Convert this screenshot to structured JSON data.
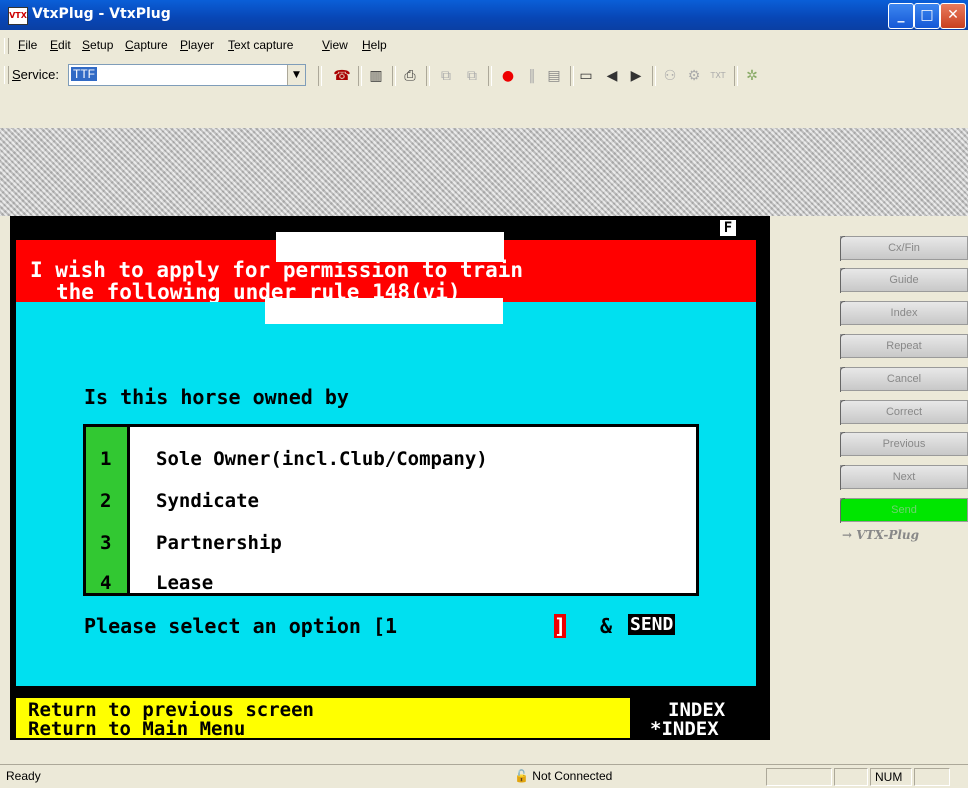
{
  "window": {
    "title": "VtxPlug - VtxPlug",
    "icon": "vtx-app-icon",
    "controls": [
      "minimize-icon",
      "maximize-icon",
      "close-icon"
    ]
  },
  "menu": [
    "File",
    "Edit",
    "Setup",
    "Capture",
    "Player",
    "Text capture",
    "View",
    "Help"
  ],
  "toolbar": {
    "service_label": "Service:",
    "service_value": "TTF",
    "icons": [
      "phone-icon",
      "book-icon",
      "print-icon",
      "copy-icon",
      "paste-icon",
      "record-icon",
      "pause-icon",
      "frame-icon",
      "frame-active-icon",
      "prev-icon",
      "next-icon",
      "users-icon",
      "capture-icon",
      "text-icon",
      "bug-icon"
    ],
    "icon_labels": {
      "text": "TXT"
    }
  },
  "terminal": {
    "flag": "F",
    "header_line1": "I wish to apply for permission to train",
    "header_line2": "the following under rule 148(vi)",
    "question": "Is this horse owned by",
    "options": [
      {
        "num": "1",
        "label": "Sole Owner(incl.Club/Company)"
      },
      {
        "num": "2",
        "label": "Syndicate"
      },
      {
        "num": "3",
        "label": "Partnership"
      },
      {
        "num": "4",
        "label": "Lease"
      }
    ],
    "prompt": "Please select an option [1",
    "prompt_cursor": "]",
    "prompt_amp": "&",
    "send_label": "SEND",
    "footer": [
      {
        "text": "Return to previous screen",
        "key": "INDEX"
      },
      {
        "text": "Return to Main Menu",
        "key": "*INDEX"
      }
    ]
  },
  "side_buttons": [
    "Cx/Fin",
    "Guide",
    "Index",
    "Repeat",
    "Cancel",
    "Correct",
    "Previous",
    "Next",
    "Send"
  ],
  "side_logo": "VTX-Plug",
  "status": {
    "ready": "Ready",
    "connection": "Not Connected",
    "num": "NUM"
  },
  "colors": {
    "title_blue": "#0846b5",
    "terminal_red": "#ff0000",
    "terminal_cyan": "#00e0f0",
    "option_green": "#32c832",
    "footer_yellow": "#ffff00",
    "send_green": "#00e600"
  }
}
